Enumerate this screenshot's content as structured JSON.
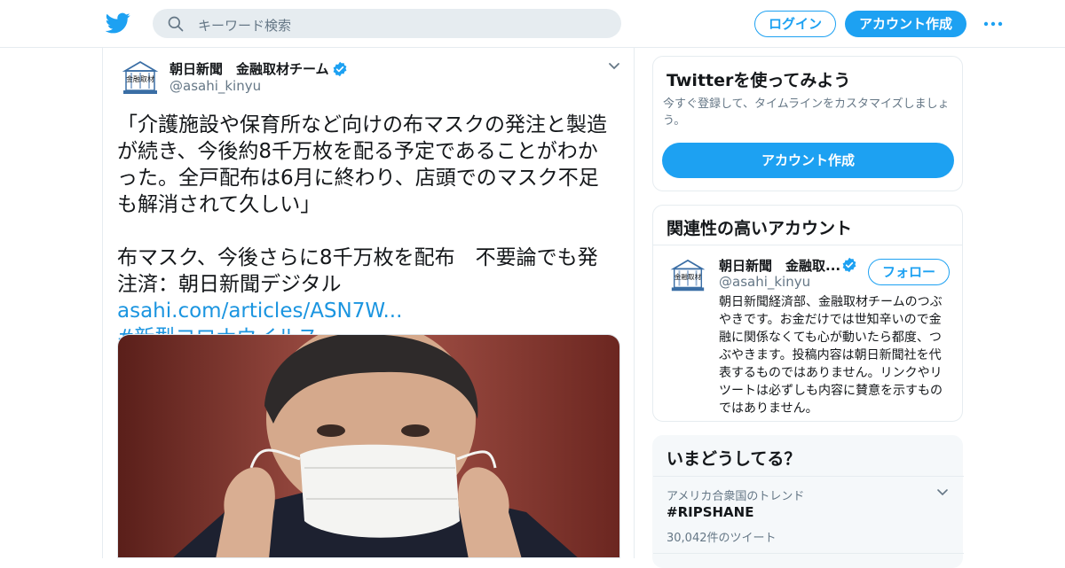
{
  "header": {
    "search_placeholder": "キーワード検索",
    "login_label": "ログイン",
    "signup_label": "アカウント作成",
    "brand_color": "#1da1f2"
  },
  "tweet": {
    "author_name": "朝日新聞　金融取材チーム",
    "author_handle": "@asahi_kinyu",
    "avatar_text": "金融取材チーム",
    "text_lines": [
      "「介護施設や保育所など向けの布マスクの発注と製造",
      "が続き、今後約8千万枚を配る予定であることがわか",
      "った。全戸配布は6月に終わり、店頭でのマスク不足",
      "も解消されて久しい」"
    ],
    "text2_line1": "布マスク、今後さらに8千万枚を配布　不要論でも発",
    "text2_line2_prefix": "注済：朝日新聞デジタル ",
    "link": "asahi.com/articles/ASN7W...",
    "hashtag": "#新型コロナウイルス",
    "media": "photo-man-with-face-mask"
  },
  "try_card": {
    "title": "Twitterを使ってみよう",
    "description": "今すぐ登録して、タイムラインをカスタマイズしましょう。",
    "cta_label": "アカウント作成"
  },
  "related_card": {
    "title": "関連性の高いアカウント",
    "name": "朝日新聞　金融取...",
    "handle": "@asahi_kinyu",
    "follow_label": "フォロー",
    "bio": "朝日新聞経済部、金融取材チームのつぶやきです。お金だけでは世知辛いので金融に関係なくても心が動いたら都度、つぶやきます。投稿内容は朝日新聞社を代表するものではありません。リンクやリツートは必ずしも内容に賛意を示すものではありません。"
  },
  "trend_card": {
    "title": "いまどうしてる？",
    "context": "アメリカ合衆国のトレンド",
    "name": "#RIPSHANE",
    "count": "30,042件のツイート"
  }
}
